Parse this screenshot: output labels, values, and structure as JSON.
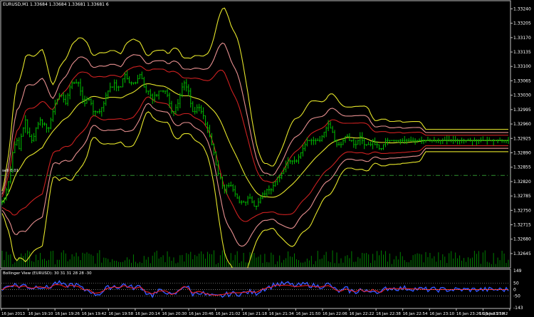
{
  "chart_title": "EURUSD,M1  1.33684 1.33684 1.33681 1.33681  6",
  "trade_line_label": "sell 0.01",
  "indicator_title": "Bollinger View (EURUSD): 30 31 31 28 28 -30",
  "colors": {
    "background": "#000000",
    "frame": "#c0c0c0",
    "candles": "#00c000",
    "volume": "#008000",
    "band_yellow": "#e5e52a",
    "band_red": "#cc2020",
    "band_salmon": "#e89090",
    "trade_line": "#2f8f2f",
    "osc_blue": "#3355ff",
    "osc_red": "#ff2020"
  },
  "price_axis": [
    "1.33240",
    "1.33205",
    "1.33170",
    "1.33135",
    "1.33100",
    "1.33065",
    "1.33030",
    "1.32995",
    "1.32960",
    "1.32925",
    "1.32890",
    "1.32855",
    "1.32820",
    "1.32785",
    "1.32750",
    "1.32715",
    "1.32680",
    "1.32645"
  ],
  "indicator_axis": [
    "149",
    "50",
    "0",
    "-50",
    "-143"
  ],
  "time_axis": [
    "16 Jan 2013",
    "16 Jan 19:10",
    "16 Jan 19:26",
    "16 Jan 19:42",
    "16 Jan 19:58",
    "16 Jan 20:14",
    "16 Jan 20:30",
    "16 Jan 20:46",
    "16 Jan 21:02",
    "16 Jan 21:18",
    "16 Jan 21:34",
    "16 Jan 21:50",
    "16 Jan 22:06",
    "16 Jan 22:22",
    "16 Jan 22:38",
    "16 Jan 22:54",
    "16 Jan 23:10",
    "16 Jan 23:26",
    "16 Jan 23:42",
    "16 Jan 23:58"
  ],
  "chart_data": {
    "type": "line",
    "x": [
      0,
      1,
      2,
      3,
      4,
      5,
      6,
      7,
      8,
      9,
      10,
      11,
      12,
      13,
      14,
      15,
      16,
      17,
      18,
      19,
      20,
      21,
      22,
      23,
      24,
      25,
      26,
      27,
      28,
      29,
      30,
      31,
      32,
      33,
      34,
      35,
      36,
      37,
      38,
      39,
      40,
      41,
      42,
      43,
      44,
      45,
      46,
      47,
      48,
      49,
      50,
      51,
      52,
      53,
      54,
      55,
      56,
      57,
      58,
      59,
      60,
      61,
      62,
      63,
      64,
      65,
      66,
      67,
      68,
      69,
      70,
      71,
      72,
      73,
      74,
      75,
      76,
      77,
      78,
      79,
      80,
      81,
      82,
      83,
      84,
      85,
      86,
      87,
      88,
      89,
      90,
      91,
      92,
      93,
      94,
      95,
      96,
      97,
      98,
      99,
      100,
      101,
      102,
      103,
      104,
      105,
      106,
      107,
      108,
      109,
      110,
      111,
      112,
      113,
      114,
      115,
      116,
      117,
      118,
      119,
      120,
      121,
      122,
      123,
      124,
      125,
      126,
      127,
      128,
      129,
      130,
      131,
      132,
      133,
      134,
      135,
      136,
      137,
      138,
      139,
      140,
      141,
      142,
      143,
      144,
      145,
      146,
      147,
      148,
      149,
      150,
      151,
      152,
      153,
      154,
      155,
      156,
      157,
      158,
      159,
      160,
      161,
      162,
      163,
      164,
      165,
      166,
      167,
      168,
      169,
      170,
      171,
      172,
      173,
      174,
      175,
      176,
      177,
      178,
      179,
      180,
      181,
      182,
      183,
      184,
      185,
      186,
      187,
      188,
      189,
      190,
      191,
      192,
      193,
      194,
      195,
      196,
      197,
      198,
      199,
      200,
      201,
      202,
      203,
      204,
      205,
      206,
      207,
      208,
      209,
      210,
      211,
      212,
      213,
      214,
      215,
      216,
      217,
      218,
      219,
      220,
      221,
      222,
      223,
      224,
      225,
      226,
      227,
      228,
      229,
      230,
      231,
      232,
      233,
      234,
      235,
      236,
      237,
      238,
      239
    ],
    "close": [
      1.3277,
      1.3278,
      1.328,
      1.3282,
      1.3285,
      1.3289,
      1.3291,
      1.3292,
      1.329,
      1.3293,
      1.3295,
      1.3297,
      1.3294,
      1.3293,
      1.3292,
      1.3293,
      1.3295,
      1.3296,
      1.3297,
      1.3296,
      1.3296,
      1.3295,
      1.3295,
      1.3297,
      1.3299,
      1.3301,
      1.3302,
      1.3303,
      1.3303,
      1.3302,
      1.3301,
      1.3303,
      1.3305,
      1.3306,
      1.3306,
      1.3306,
      1.3306,
      1.3304,
      1.3302,
      1.3301,
      1.3302,
      1.3302,
      1.3301,
      1.3299,
      1.3299,
      1.3299,
      1.3299,
      1.33,
      1.3301,
      1.3303,
      1.3304,
      1.3305,
      1.3305,
      1.3306,
      1.3305,
      1.3305,
      1.3305,
      1.3307,
      1.3308,
      1.3307,
      1.3306,
      1.3306,
      1.3306,
      1.3306,
      1.3307,
      1.3308,
      1.3307,
      1.3305,
      1.3304,
      1.3304,
      1.3303,
      1.3302,
      1.3303,
      1.3303,
      1.3304,
      1.3304,
      1.3304,
      1.3304,
      1.3303,
      1.3301,
      1.3299,
      1.3299,
      1.33,
      1.3301,
      1.3303,
      1.3305,
      1.3306,
      1.3305,
      1.3304,
      1.3301,
      1.3299,
      1.3299,
      1.33,
      1.33,
      1.3299,
      1.3298,
      1.3296,
      1.3295,
      1.3293,
      1.3291,
      1.3289,
      1.3286,
      1.3284,
      1.3283,
      1.3281,
      1.328,
      1.3281,
      1.3281,
      1.3281,
      1.328,
      1.3279,
      1.3278,
      1.3277,
      1.3277,
      1.3277,
      1.3277,
      1.3278,
      1.3278,
      1.3277,
      1.3276,
      1.3276,
      1.3277,
      1.3278,
      1.3279,
      1.3279,
      1.328,
      1.328,
      1.328,
      1.3281,
      1.3282,
      1.3283,
      1.3283,
      1.3284,
      1.3285,
      1.3286,
      1.3287,
      1.3287,
      1.3287,
      1.3287,
      1.3287,
      1.3288,
      1.3289,
      1.329,
      1.3291,
      1.3292,
      1.3292,
      1.3292,
      1.3292,
      1.3292,
      1.3292,
      1.3292,
      1.3293,
      1.3294,
      1.3295,
      1.3296,
      1.3295,
      1.3294,
      1.3292,
      1.3291,
      1.3291,
      1.3291,
      1.3292,
      1.3293,
      1.3293,
      1.3292,
      1.3292,
      1.3291,
      1.3291,
      1.3292,
      1.3293,
      1.3292,
      1.3291,
      1.3291,
      1.3291,
      1.3291,
      1.3292,
      1.3291,
      1.3291,
      1.329,
      1.329,
      1.3291,
      1.3292,
      1.3292,
      1.3292,
      1.3292,
      1.3292,
      1.3292,
      1.3292,
      1.3292,
      1.3292,
      1.3292,
      1.3292,
      1.3292,
      1.3292,
      1.3292,
      1.3292,
      1.3292,
      1.3292,
      1.3292,
      1.3292,
      1.3292,
      1.3292,
      1.3292,
      1.3292,
      1.3292,
      1.3292,
      1.3292,
      1.3292,
      1.3292,
      1.3292,
      1.3292,
      1.3292,
      1.3292,
      1.3292,
      1.3292,
      1.3292,
      1.3292,
      1.3292,
      1.3292,
      1.3292,
      1.3292,
      1.3292,
      1.3292,
      1.3292,
      1.3292,
      1.3292,
      1.3292,
      1.3292,
      1.3292,
      1.3292,
      1.3292,
      1.3292,
      1.3292,
      1.3292,
      1.3292,
      1.3292,
      1.3292,
      1.3292,
      1.3292,
      1.3292
    ],
    "trade_level": 1.32835,
    "ylim": [
      1.32612,
      1.33258
    ],
    "indicator_ylim": [
      -143,
      149
    ],
    "indicator_levels": [
      50,
      0,
      -50
    ]
  }
}
